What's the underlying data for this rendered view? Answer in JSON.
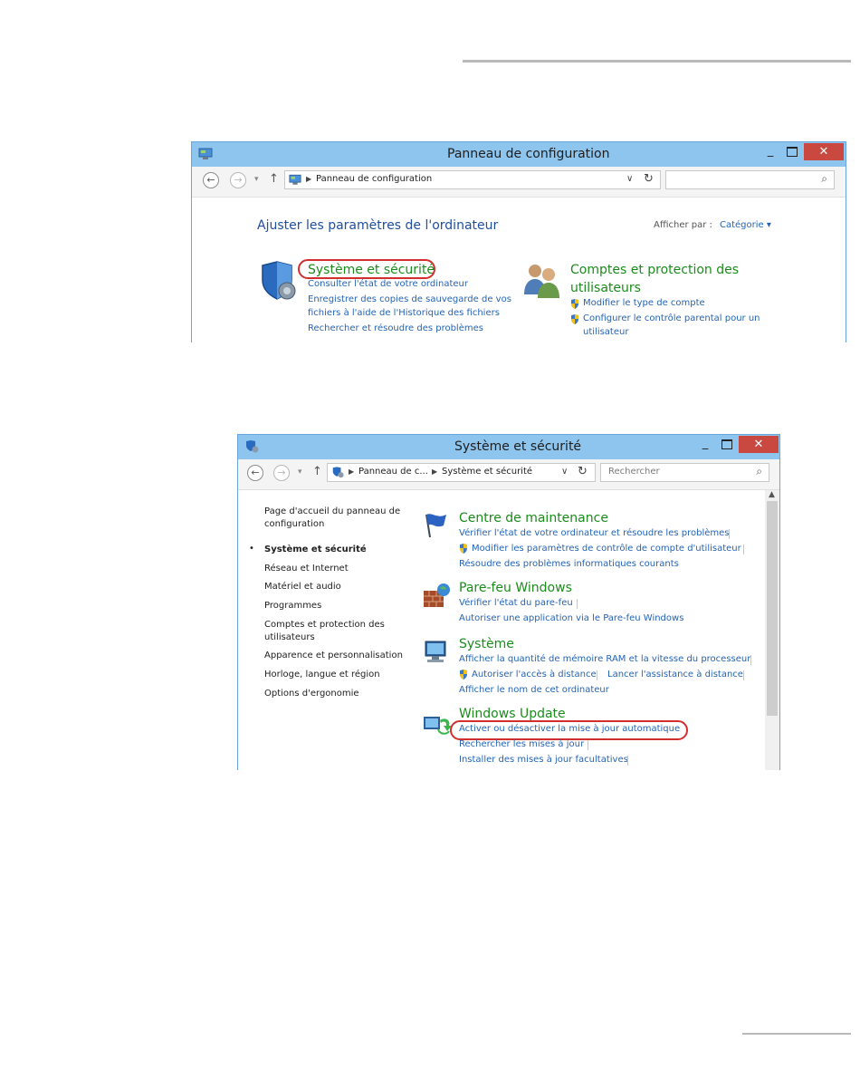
{
  "window1": {
    "title": "Panneau de configuration",
    "address_crumb": "Panneau de configuration",
    "search_placeholder": "",
    "heading": "Ajuster les paramètres de l'ordinateur",
    "view_by_label": "Afficher par :",
    "view_by_value": "Catégorie ▾",
    "categories": [
      {
        "title": "Système et sécurité",
        "icon": "shield-icon",
        "links": [
          "Consulter l'état de votre ordinateur",
          "Enregistrer des copies de sauvegarde de vos",
          "fichiers à l'aide de l'Historique des fichiers",
          "Rechercher et résoudre des problèmes"
        ]
      },
      {
        "title_line1": "Comptes et protection des",
        "title_line2": "utilisateurs",
        "icon": "users-icon",
        "links": [
          "Modifier le type de compte",
          "Configurer le contrôle parental pour un",
          "utilisateur"
        ]
      }
    ]
  },
  "window2": {
    "title": "Système et sécurité",
    "crumb1": "Panneau de c...",
    "crumb2": "Système et sécurité",
    "search_placeholder": "Rechercher",
    "sidebar": [
      {
        "label_line1": "Page d'accueil du panneau de",
        "label_line2": "configuration",
        "active": false
      },
      {
        "label": "Système et sécurité",
        "active": true
      },
      {
        "label": "Réseau et Internet",
        "active": false
      },
      {
        "label": "Matériel et audio",
        "active": false
      },
      {
        "label": "Programmes",
        "active": false
      },
      {
        "label_line1": "Comptes et protection des",
        "label_line2": "utilisateurs",
        "active": false
      },
      {
        "label": "Apparence et personnalisation",
        "active": false
      },
      {
        "label": "Horloge, langue et région",
        "active": false
      },
      {
        "label": "Options d'ergonomie",
        "active": false
      }
    ],
    "sections": [
      {
        "title": "Centre de maintenance",
        "icon": "flag-icon",
        "links": [
          "Vérifier l'état de votre ordinateur et résoudre les problèmes",
          "Modifier les paramètres de contrôle de compte d'utilisateur",
          "Résoudre des problèmes informatiques courants"
        ]
      },
      {
        "title": "Pare-feu Windows",
        "icon": "firewall-icon",
        "links": [
          "Vérifier l'état du pare-feu",
          "Autoriser une application via le Pare-feu Windows"
        ]
      },
      {
        "title": "Système",
        "icon": "computer-icon",
        "links": [
          "Afficher la quantité de mémoire RAM et la vitesse du processeur",
          "Autoriser l'accès à distance",
          "Lancer l'assistance à distance",
          "Afficher le nom de cet ordinateur"
        ]
      },
      {
        "title": "Windows Update",
        "icon": "windows-update-icon",
        "links": [
          "Activer ou désactiver la mise à jour automatique",
          "Rechercher les mises à jour",
          "Installer des mises à jour facultatives"
        ]
      }
    ]
  },
  "colors": {
    "titlebar": "#8ec5ee",
    "close": "#c9483f",
    "link": "#2464b4",
    "green_heading": "#1b8c1b",
    "highlight_ring": "#d32f2f"
  }
}
